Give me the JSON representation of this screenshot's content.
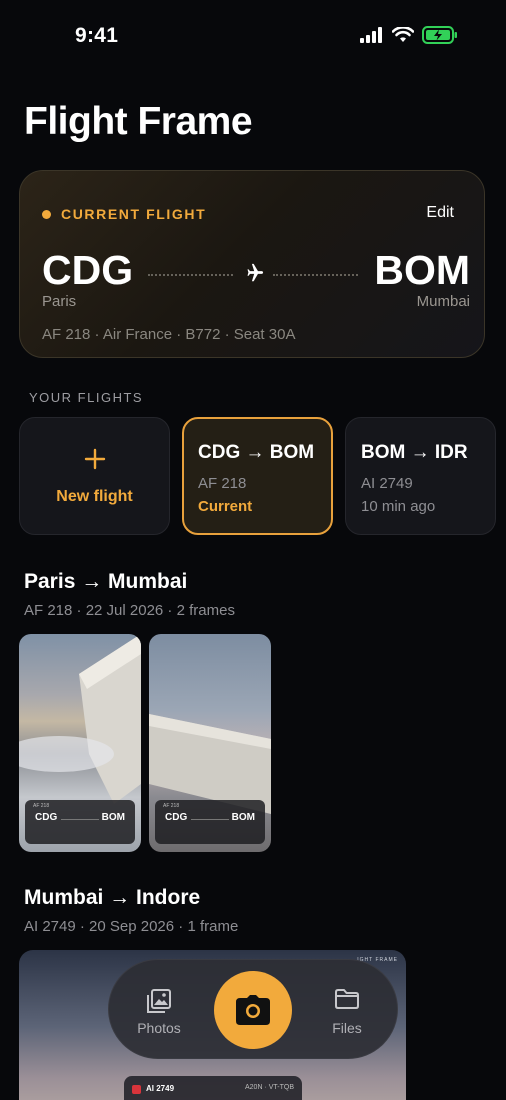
{
  "status_bar": {
    "time": "9:41"
  },
  "app": {
    "title": "Flight Frame"
  },
  "current_flight": {
    "label": "CURRENT FLIGHT",
    "edit_label": "Edit",
    "from_code": "CDG",
    "from_city": "Paris",
    "to_code": "BOM",
    "to_city": "Mumbai",
    "details": "AF 218 · Air France · B772 · Seat 30A"
  },
  "your_flights": {
    "label": "YOUR FLIGHTS",
    "new_flight_label": "New flight",
    "tiles": [
      {
        "route": "CDG → BOM",
        "code": "AF 218",
        "status": "Current"
      },
      {
        "route": "BOM → IDR",
        "code": "AI 2749",
        "status": "10 min ago"
      }
    ]
  },
  "trips": [
    {
      "title": "Paris → Mumbai",
      "meta": "AF 218 · 22 Jul 2026 · 2 frames",
      "frames": [
        {
          "from": "CDG",
          "to": "BOM",
          "flight": "AF 218"
        },
        {
          "from": "CDG",
          "to": "BOM",
          "flight": "AF 218"
        }
      ]
    },
    {
      "title": "Mumbai → Indore",
      "meta": "AI 2749 · 20 Sep 2026 · 1 frame",
      "frames": [
        {
          "watermark": "IGHT FRAME",
          "flight": "AI 2749",
          "reg": "A20N · VT-TQB"
        }
      ]
    }
  ],
  "tabbar": {
    "photos_label": "Photos",
    "files_label": "Files"
  },
  "colors": {
    "accent": "#f2aa3c",
    "background": "#07080b",
    "tile": "#15161b"
  },
  "icons": [
    "signal-icon",
    "wifi-icon",
    "battery-icon",
    "plane-icon",
    "plus-icon",
    "photos-icon",
    "camera-icon",
    "folder-icon"
  ]
}
